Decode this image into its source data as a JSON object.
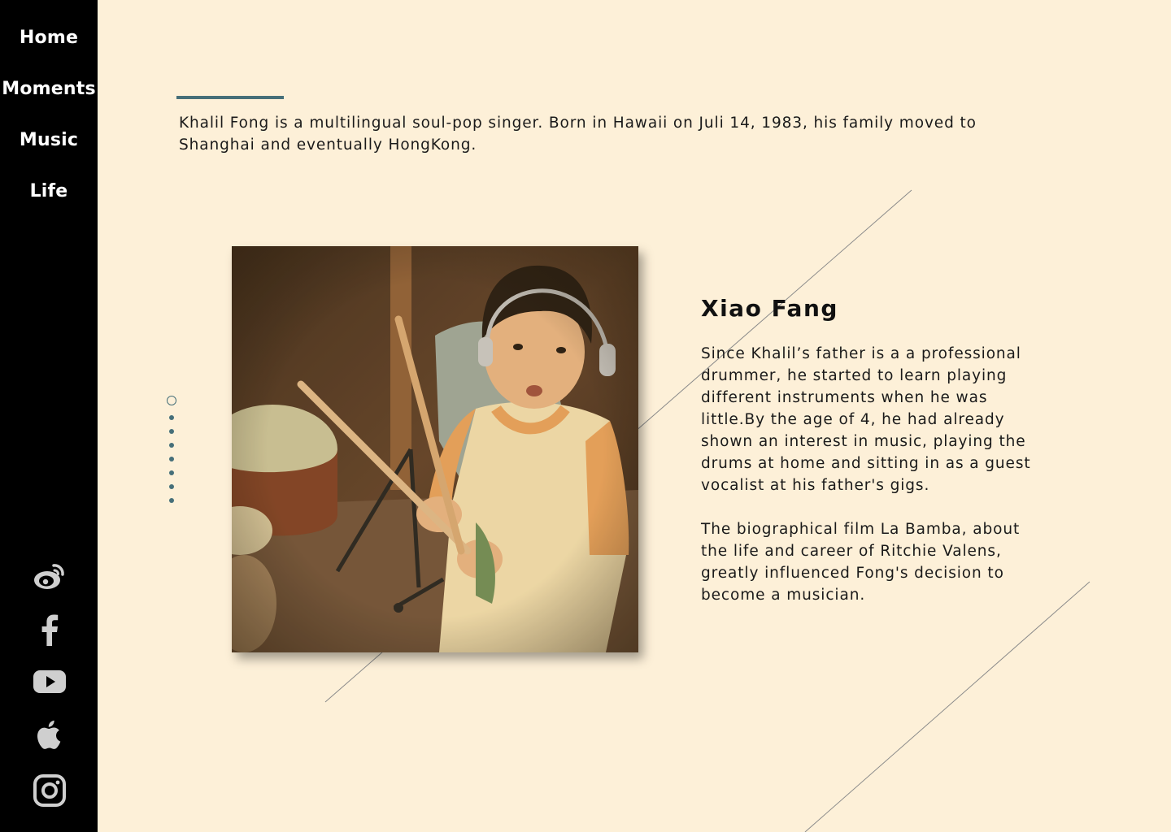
{
  "nav": {
    "items": [
      {
        "label": "Home"
      },
      {
        "label": "Moments"
      },
      {
        "label": "Music"
      },
      {
        "label": "Life"
      }
    ]
  },
  "social": {
    "icons": [
      "weibo-icon",
      "facebook-icon",
      "youtube-icon",
      "apple-icon",
      "instagram-icon"
    ]
  },
  "intro": {
    "text": "Khalil Fong is a multilingual soul-pop singer. Born in Hawaii on Juli 14, 1983, his family moved to Shanghai and eventually HongKong."
  },
  "section": {
    "title": "Xiao Fang",
    "paragraphs": [
      "Since Khalil’s father is a a professional drummer, he started to learn playing different instruments when he was little.By the age of 4, he had already shown an interest in music, playing the drums at home and sitting in as a guest vocalist at his father's gigs.",
      "The biographical film La Bamba, about the life and career of Ritchie Valens, greatly influenced Fong's decision to become a musician."
    ]
  },
  "pager": {
    "count": 8,
    "active_index": 0
  },
  "colors": {
    "background": "#fdf0d8",
    "sidebar": "#000000",
    "accent": "#466f79",
    "text": "#1a1a1a"
  }
}
